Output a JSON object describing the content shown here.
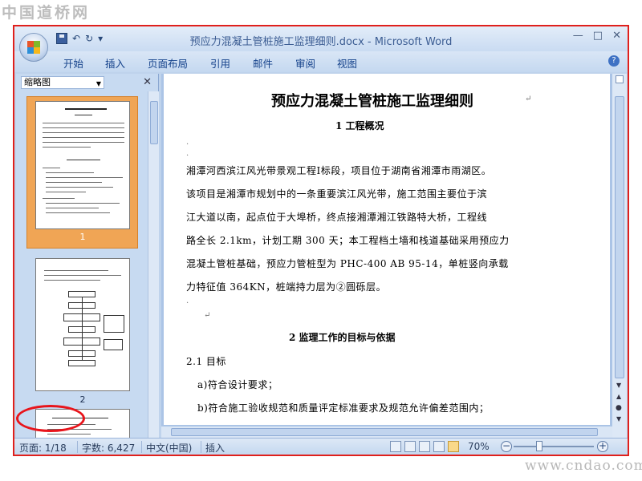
{
  "watermark": {
    "site_name": "中国道桥网",
    "url": "www.cndao.com"
  },
  "window": {
    "title": "预应力混凝土管桩施工监理细则.docx - Microsoft Word",
    "controls": [
      "—",
      "□",
      "✕"
    ]
  },
  "qat": {
    "undo": "↶",
    "redo": "↻",
    "customize": "▾"
  },
  "ribbon": {
    "tabs": [
      "开始",
      "插入",
      "页面布局",
      "引用",
      "邮件",
      "审阅",
      "视图"
    ],
    "help": "?"
  },
  "thumbnails": {
    "dropdown_label": "缩略图",
    "close": "✕",
    "pages": [
      "1",
      "2"
    ]
  },
  "document": {
    "title": "预应力混凝土管桩施工监理细则",
    "heading1": "1  工程概况",
    "para_lines": [
      "湘潭河西滨江风光带景观工程Ⅰ标段，项目位于湖南省湘潭市雨湖区。",
      "该项目是湘潭市规划中的一条重要滨江风光带，施工范围主要位于滨",
      "江大道以南，起点位于大埠桥，终点接湘潭湘江铁路特大桥，工程线",
      "路全长 2.1km，计划工期 300 天；本工程档土墙和栈道基础采用预应力",
      "混凝土管桩基础，预应力管桩型为 PHC-400 AB 95-14，单桩竖向承载",
      "力特征值 364KN，桩端持力层为②圆砾层。"
    ],
    "heading2": "2  监理工作的目标与依据",
    "sub_heading": "2.1 目标",
    "items": [
      "a)符合设计要求；",
      "b)符合施工验收规范和质量评定标准要求及规范允许偏差范围内；"
    ],
    "paragraph_mark": "↵"
  },
  "statusbar": {
    "page": "页面: 1/18",
    "words": "字数: 6,427",
    "language": "中文(中国)",
    "mode": "插入",
    "zoom": "70%",
    "zoom_out": "−",
    "zoom_in": "+"
  },
  "colors": {
    "accent": "#15428b",
    "selected_thumb": "#f0a555",
    "highlight_ring": "#e8141b"
  }
}
